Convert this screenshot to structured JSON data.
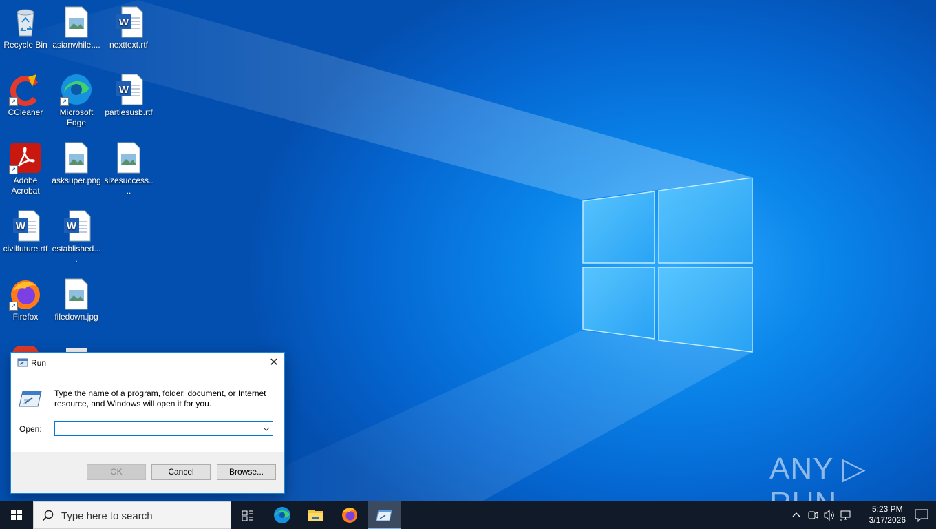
{
  "desktop": {
    "icons": [
      {
        "label": "Recycle Bin",
        "type": "recycle"
      },
      {
        "label": "asianwhile....",
        "type": "image"
      },
      {
        "label": "nexttext.rtf",
        "type": "word"
      },
      {
        "label": "CCleaner",
        "type": "ccleaner"
      },
      {
        "label": "Microsoft Edge",
        "type": "edge"
      },
      {
        "label": "partiesusb.rtf",
        "type": "word"
      },
      {
        "label": "Adobe Acrobat",
        "type": "acrobat"
      },
      {
        "label": "asksuper.png",
        "type": "image"
      },
      {
        "label": "sizesuccess....",
        "type": "image"
      },
      {
        "label": "civilfuture.rtf",
        "type": "word"
      },
      {
        "label": "established....",
        "type": "word"
      },
      {
        "label": "Firefox",
        "type": "firefox"
      },
      {
        "label": "filedown.jpg",
        "type": "image"
      }
    ]
  },
  "run_dialog": {
    "title": "Run",
    "message": "Type the name of a program, folder, document, or Internet resource, and Windows will open it for you.",
    "open_label": "Open:",
    "open_value": "",
    "ok_label": "OK",
    "cancel_label": "Cancel",
    "browse_label": "Browse..."
  },
  "watermark": "ANY ▷ RUN",
  "taskbar": {
    "search_placeholder": "Type here to search",
    "time": "5:23 PM",
    "date": "3/17/2026",
    "apps": [
      "task-view",
      "edge",
      "file-explorer",
      "firefox",
      "run"
    ]
  },
  "colors": {
    "desktop_blue": "#0a86ea",
    "taskbar": "#101a28",
    "accent": "#0078d7"
  }
}
